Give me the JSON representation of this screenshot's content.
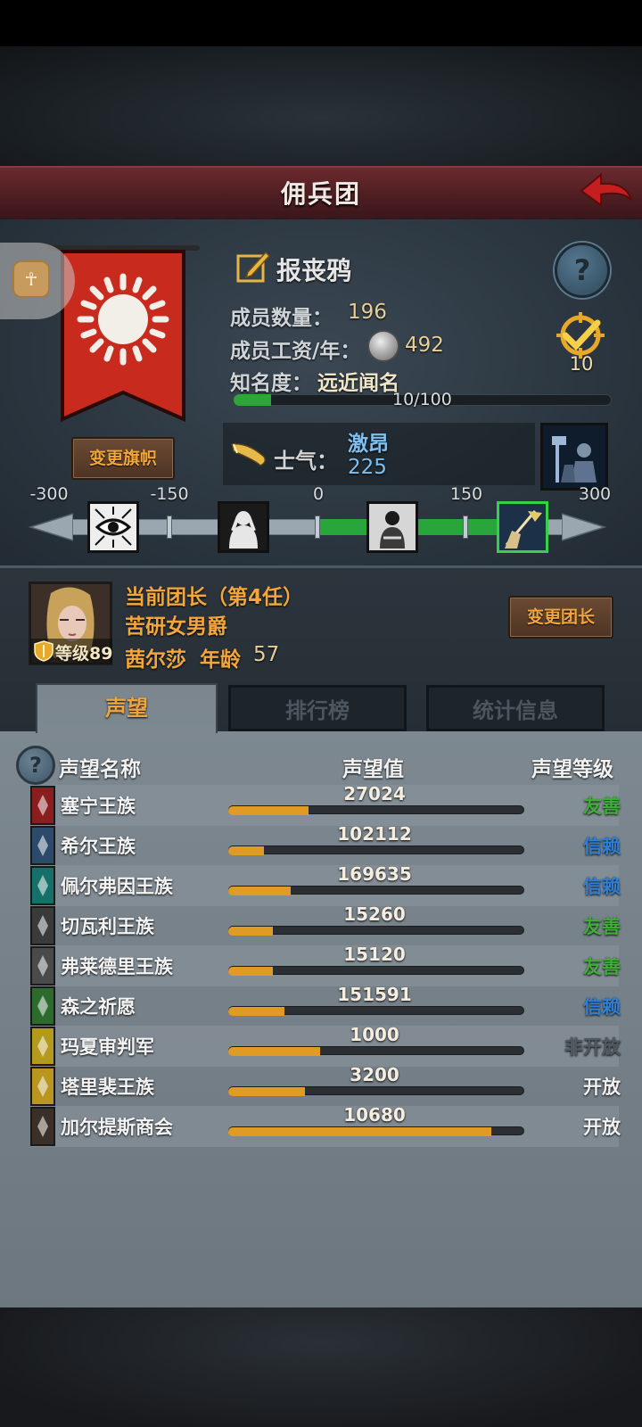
{
  "header": {
    "title": "佣兵团"
  },
  "mercenary": {
    "name": "报丧鸦",
    "members_label": "成员数量：",
    "members_value": "196",
    "salary_label": "成员工资/年：",
    "salary_value": "492",
    "fame_label": "知名度：",
    "fame_value": "远近闻名",
    "fame_progress_text": "10/100",
    "fame_progress": 0.1,
    "rank_value": "10"
  },
  "buttons": {
    "change_banner": "变更旗帜",
    "change_leader": "变更团长"
  },
  "morale": {
    "label": "士气：",
    "state": "激昂",
    "value": "225",
    "scale_labels": [
      "-300",
      "-150",
      "0",
      "150",
      "300"
    ],
    "scale_min": -300,
    "scale_max": 300,
    "current": 225
  },
  "leader": {
    "title": "当前团长（第4任）",
    "class": "苦研女男爵",
    "level_text": "等级89",
    "name": "茜尔莎",
    "age_label": "年龄",
    "age": "57"
  },
  "tabs": [
    "声望",
    "排行榜",
    "统计信息"
  ],
  "list": {
    "headers": {
      "name": "声望名称",
      "value": "声望值",
      "level": "声望等级"
    },
    "rows": [
      {
        "name": "塞宁王族",
        "value": "27024",
        "progress": 0.27,
        "level": "友善",
        "level_color": "#3fae38",
        "icon_color": "#8a1e1e",
        "icon": "red-sword-crest-icon"
      },
      {
        "name": "希尔王族",
        "value": "102112",
        "progress": 0.12,
        "level": "信赖",
        "level_color": "#2f7fd4",
        "icon_color": "#2c4a6a",
        "icon": "blue-bell-crest-icon"
      },
      {
        "name": "佩尔弗因王族",
        "value": "169635",
        "progress": 0.21,
        "level": "信赖",
        "level_color": "#2f7fd4",
        "icon_color": "#16706a",
        "icon": "teal-moon-crest-icon"
      },
      {
        "name": "切瓦利王族",
        "value": "15260",
        "progress": 0.15,
        "level": "友善",
        "level_color": "#3fae38",
        "icon_color": "#3a3a3a",
        "icon": "scales-crest-icon"
      },
      {
        "name": "弗莱德里王族",
        "value": "15120",
        "progress": 0.15,
        "level": "友善",
        "level_color": "#3fae38",
        "icon_color": "#4a4a4a",
        "icon": "wolf-crest-icon"
      },
      {
        "name": "森之祈愿",
        "value": "151591",
        "progress": 0.19,
        "level": "信赖",
        "level_color": "#2f7fd4",
        "icon_color": "#2d6a2d",
        "icon": "tree-crest-icon"
      },
      {
        "name": "玛夏审判军",
        "value": "1000",
        "progress": 0.31,
        "level": "非开放",
        "level_color": "#4f5960",
        "icon_color": "#b39a1c",
        "icon": "cross-crest-icon"
      },
      {
        "name": "塔里裴王族",
        "value": "3200",
        "progress": 0.26,
        "level": "开放",
        "level_color": "#f2f2f2",
        "icon_color": "#b89620",
        "icon": "flame-crest-icon"
      },
      {
        "name": "加尔提斯商会",
        "value": "10680",
        "progress": 0.89,
        "level": "开放",
        "level_color": "#f2f2f2",
        "icon_color": "#3a3027",
        "icon": "chest-crest-icon"
      }
    ]
  }
}
